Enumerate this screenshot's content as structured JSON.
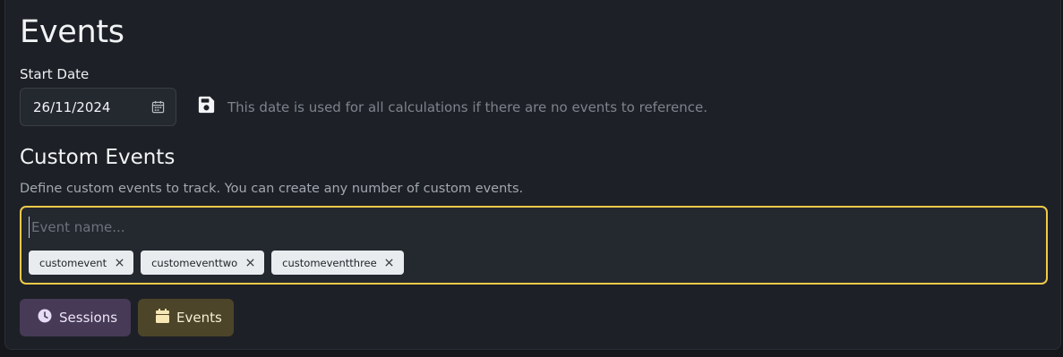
{
  "page": {
    "title": "Events"
  },
  "start_date": {
    "label": "Start Date",
    "value": "26/11/2024",
    "help": "This date is used for all calculations if there are no events to reference."
  },
  "custom_events": {
    "title": "Custom Events",
    "description": "Define custom events to track. You can create any number of custom events.",
    "input_placeholder": "Event name...",
    "tags": [
      {
        "label": "customevent"
      },
      {
        "label": "customeventtwo"
      },
      {
        "label": "customeventthree"
      }
    ]
  },
  "nav": {
    "sessions_label": "Sessions",
    "events_label": "Events"
  },
  "colors": {
    "accent_focus": "#f0c94a",
    "sessions_bg": "#463a57",
    "events_bg": "#4d4529"
  },
  "icons": {
    "calendar": "calendar-icon",
    "save": "floppy-disk-icon",
    "clock": "clock-icon",
    "remove": "close-icon"
  }
}
